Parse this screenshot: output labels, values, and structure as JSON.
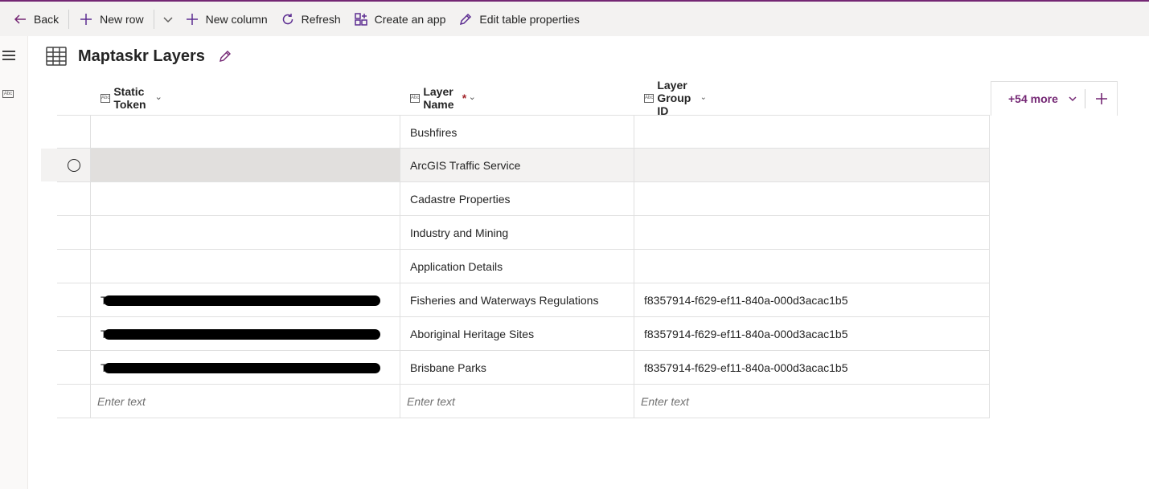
{
  "toolbar": {
    "back_label": "Back",
    "new_row_label": "New row",
    "new_column_label": "New column",
    "refresh_label": "Refresh",
    "create_app_label": "Create an app",
    "edit_table_label": "Edit table properties"
  },
  "page": {
    "title": "Maptaskr Layers"
  },
  "columns": [
    {
      "label": "Static Token",
      "required": false
    },
    {
      "label": "Layer Name",
      "required": true,
      "required_mark": "*"
    },
    {
      "label": "Layer Group ID",
      "required": false
    }
  ],
  "rows": [
    {
      "static_token": "",
      "layer_name": "Bushfires",
      "layer_group_id": ""
    },
    {
      "static_token": "",
      "layer_name": "ArcGIS Traffic Service",
      "layer_group_id": "",
      "selected": true
    },
    {
      "static_token": "",
      "layer_name": "Cadastre Properties",
      "layer_group_id": ""
    },
    {
      "static_token": "",
      "layer_name": "Industry and Mining",
      "layer_group_id": ""
    },
    {
      "static_token": "",
      "layer_name": "Application Details",
      "layer_group_id": ""
    },
    {
      "static_token": "T",
      "static_token_redacted": true,
      "layer_name": "Fisheries and Waterways Regulations",
      "layer_group_id": "f8357914-f629-ef11-840a-000d3acac1b5"
    },
    {
      "static_token": "T",
      "static_token_redacted": true,
      "layer_name": "Aboriginal Heritage Sites",
      "layer_group_id": "f8357914-f629-ef11-840a-000d3acac1b5"
    },
    {
      "static_token": "T",
      "static_token_redacted": true,
      "layer_name": "Brisbane Parks",
      "layer_group_id": "f8357914-f629-ef11-840a-000d3acac1b5"
    }
  ],
  "new_row": {
    "placeholder": "Enter text"
  },
  "more_columns": {
    "label": "+54 more"
  },
  "colors": {
    "accent": "#742774",
    "required": "#a4262c"
  }
}
